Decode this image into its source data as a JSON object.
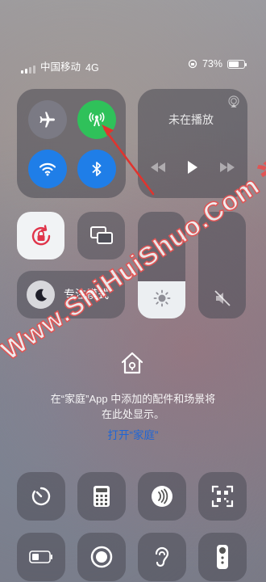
{
  "status_bar": {
    "carrier": "中国移动",
    "network": "4G",
    "battery_percent": "73%",
    "battery_level": 0.73
  },
  "connectivity": {
    "airplane": {
      "icon": "airplane-icon",
      "active": false
    },
    "cellular": {
      "icon": "cellular-antenna-icon",
      "active": true,
      "color": "#2fc15a"
    },
    "wifi": {
      "icon": "wifi-icon",
      "active": true,
      "color": "#1f7ee8"
    },
    "bluetooth": {
      "icon": "bluetooth-icon",
      "active": true,
      "color": "#1f7ee8"
    }
  },
  "music": {
    "title": "未在播放"
  },
  "focus": {
    "label": "专注模式"
  },
  "brightness": {
    "level": 0.35
  },
  "volume": {
    "level": 0,
    "muted": true
  },
  "home": {
    "line1": "在“家庭”App 中添加的配件和场景将",
    "line2": "在此处显示。",
    "link": "打开“家庭”"
  },
  "bottom_row1": [
    "timer-icon",
    "calculator-icon",
    "nfc-icon",
    "qr-scanner-icon"
  ],
  "bottom_row2": [
    "low-power-mode-icon",
    "screen-record-icon",
    "hearing-icon",
    "apple-tv-remote-icon"
  ],
  "watermark": {
    "text": "Www.ShiHuiShuo.Com 适会说"
  }
}
